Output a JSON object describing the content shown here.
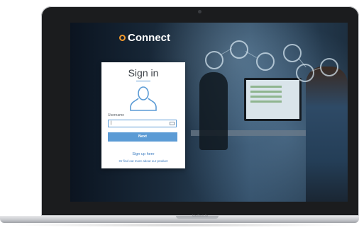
{
  "brand": {
    "name": "Connect",
    "mark_color": "#f29a2e"
  },
  "signin": {
    "title": "Sign in",
    "username_label": "Username",
    "username_value": "|",
    "next_label": "Next",
    "signup_link": "Sign up here",
    "more_link": "Or find out more about our product"
  },
  "device": {
    "label": "MacBook Air"
  },
  "icons": [
    "connect-logo-icon",
    "user-avatar-icon",
    "mail-icon",
    "camera"
  ],
  "colors": {
    "accent": "#5b9bd5",
    "link": "#3a7bc0"
  }
}
